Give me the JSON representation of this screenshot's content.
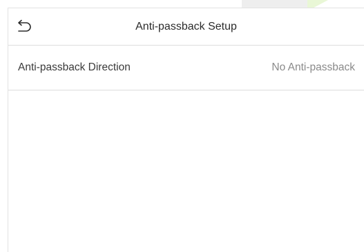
{
  "header": {
    "title": "Anti-passback Setup",
    "back_icon": "back-arrow-icon"
  },
  "settings": [
    {
      "label": "Anti-passback Direction",
      "value": "No Anti-passback"
    }
  ],
  "colors": {
    "background": "#ffffff",
    "divider": "#dcdcdc",
    "label_text": "#3a3a3a",
    "value_text": "#8a8a8a"
  }
}
